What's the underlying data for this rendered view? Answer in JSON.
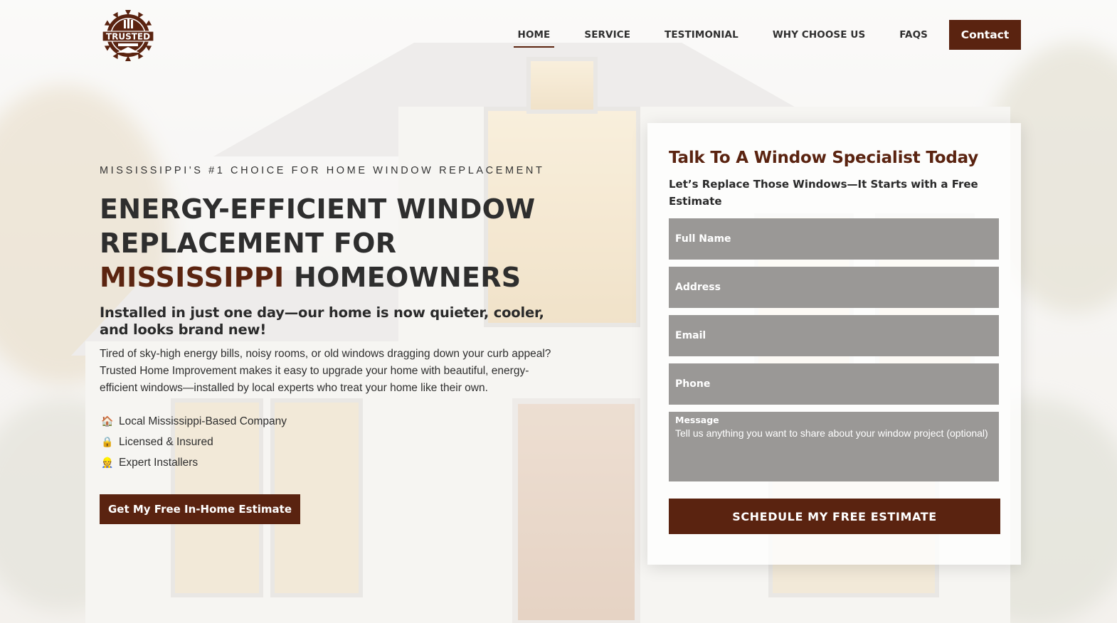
{
  "brand": {
    "logo_text": "TRUSTED",
    "primary_color": "#5a2310"
  },
  "nav": {
    "items": [
      {
        "label": "HOME",
        "active": true
      },
      {
        "label": "SERVICE",
        "active": false
      },
      {
        "label": "TESTIMONIAL",
        "active": false
      },
      {
        "label": "WHY CHOOSE US",
        "active": false
      },
      {
        "label": "FAQS",
        "active": false
      }
    ],
    "contact_label": "Contact"
  },
  "hero": {
    "eyebrow": "MISSISSIPPI'S #1 CHOICE FOR HOME WINDOW REPLACEMENT",
    "headline_line1": "ENERGY-EFFICIENT WINDOW",
    "headline_line2": "REPLACEMENT FOR",
    "headline_accent": "MISSISSIPPI",
    "headline_line3_rest": " HOMEOWNERS",
    "subhead": "Installed in just one day—our home is now quieter, cooler, and looks brand new!",
    "body": "Tired of sky-high energy bills, noisy rooms, or old windows dragging down your curb appeal? Trusted Home Improvement makes it easy to upgrade your home with beautiful, energy-efficient windows—installed by local experts who treat your home like their own.",
    "features": [
      {
        "icon": "house-icon",
        "glyph": "🏠",
        "label": "Local Mississippi-Based Company"
      },
      {
        "icon": "lock-icon",
        "glyph": "🔒",
        "label": "Licensed & Insured"
      },
      {
        "icon": "worker-icon",
        "glyph": "👷",
        "label": "Expert Installers"
      }
    ],
    "cta_label": "Get My Free In-Home Estimate"
  },
  "form": {
    "title": "Talk To A Window Specialist Today",
    "subtitle": "Let’s Replace Those Windows—It Starts with a Free Estimate",
    "fields": [
      {
        "placeholder": "Full Name"
      },
      {
        "placeholder": "Address"
      },
      {
        "placeholder": "Email"
      },
      {
        "placeholder": "Phone"
      }
    ],
    "message_label": "Message",
    "message_placeholder": "Tell us anything you want to share about your window project (optional)",
    "submit_label": "SCHEDULE MY FREE ESTIMATE"
  }
}
